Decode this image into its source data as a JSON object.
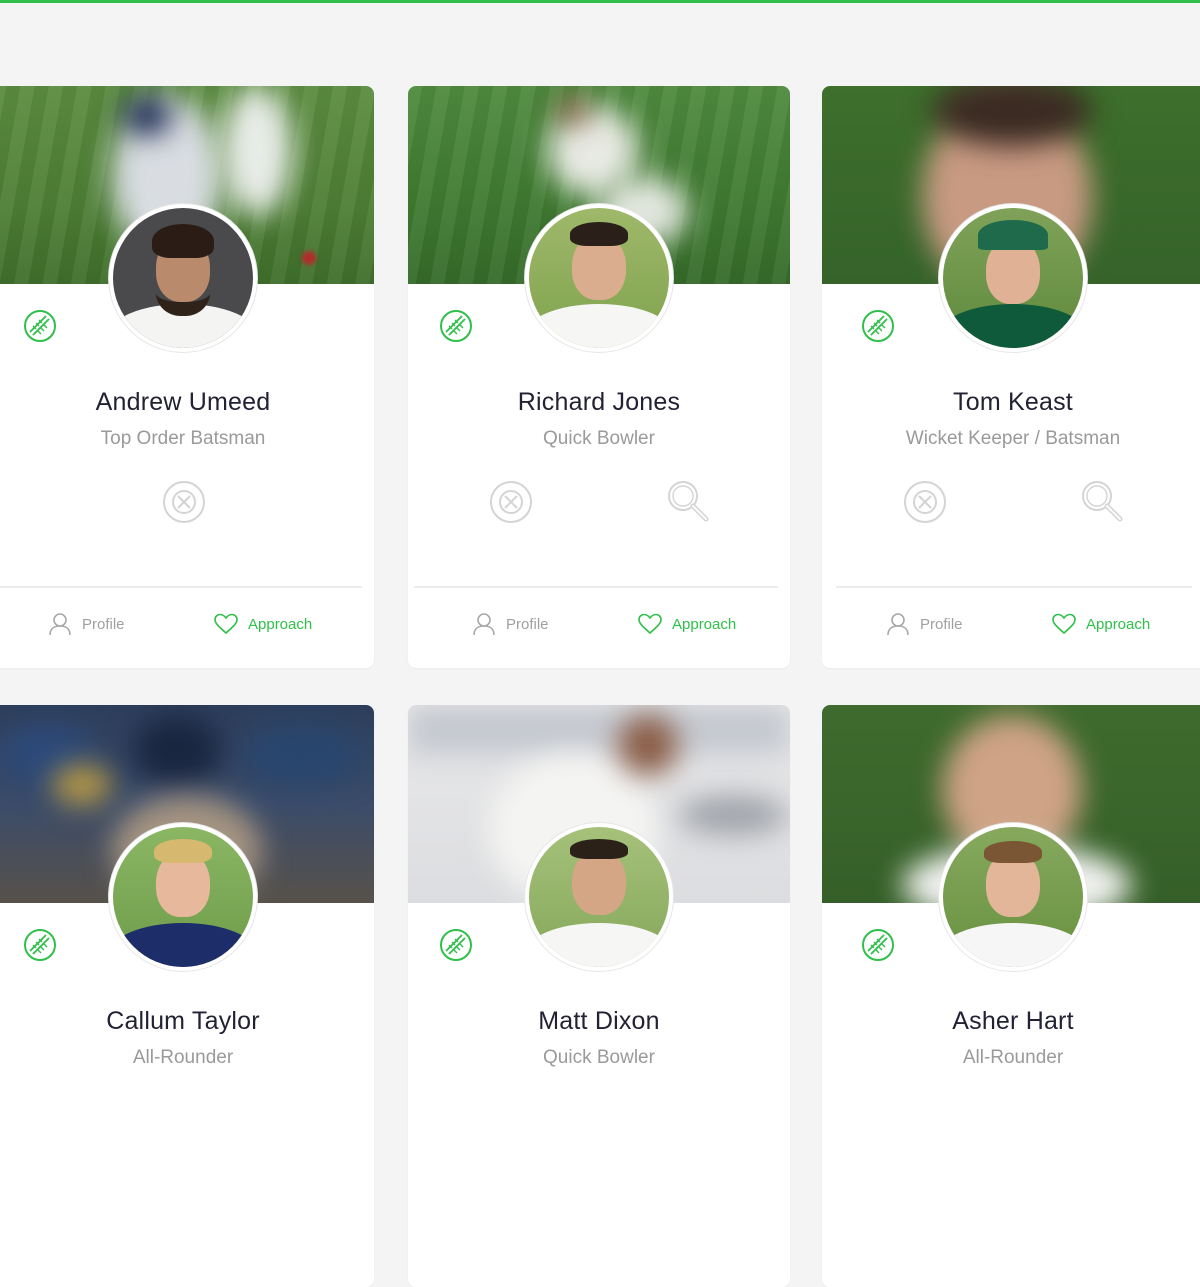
{
  "theme": {
    "accent": "#2fbf4a",
    "name_color": "#222234",
    "muted": "#9a9a9a",
    "background": "#f4f4f4"
  },
  "footer_labels": {
    "profile": "Profile",
    "approach": "Approach"
  },
  "players": [
    {
      "name": "Andrew Umeed",
      "role": "Top Order Batsman",
      "actions": [
        "remove-icon"
      ]
    },
    {
      "name": "Richard Jones",
      "role": "Quick Bowler",
      "actions": [
        "remove-icon",
        "search-icon"
      ]
    },
    {
      "name": "Tom Keast",
      "role": "Wicket Keeper / Batsman",
      "actions": [
        "remove-icon",
        "search-icon"
      ]
    },
    {
      "name": "Callum Taylor",
      "role": "All-Rounder"
    },
    {
      "name": "Matt Dixon",
      "role": "Quick Bowler"
    },
    {
      "name": "Asher Hart",
      "role": "All-Rounder"
    }
  ]
}
